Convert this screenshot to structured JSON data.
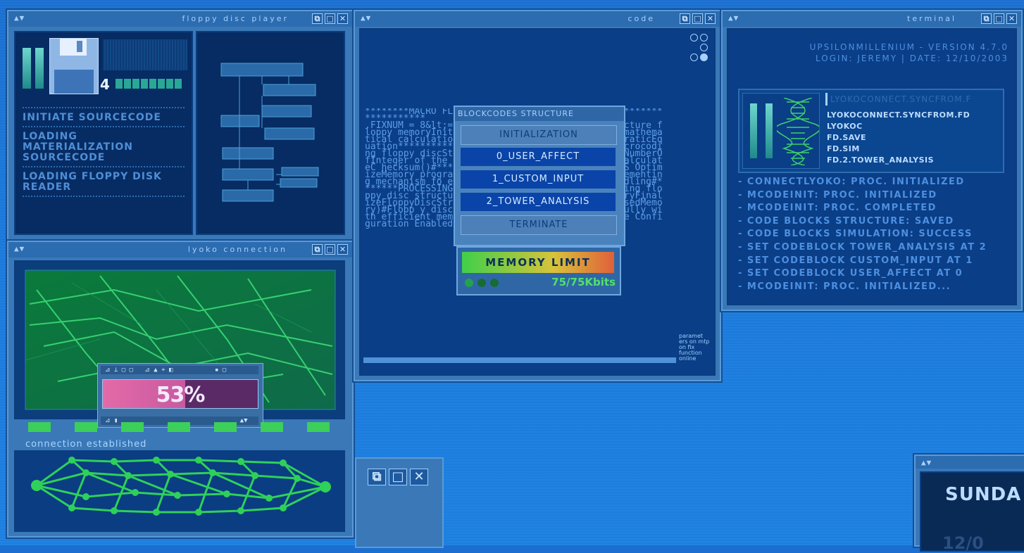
{
  "floppy": {
    "title": "floppy disc player",
    "track_number": "4",
    "menu": [
      "INITIATE SOURCECODE",
      "LOADING MATERIALIZATION SOURCECODE",
      "LOADING FLOPPY DISK READER"
    ]
  },
  "code": {
    "title": "code",
    "text": "********MACRO FLOPPY*********************************************\n.FIXNUM = 8&lt;=Number of macrocoding disc structure floppy memoryInitial AllocateMemory macrocoding mathematical calculations algorithm[Sl neFunction QuadraticEquation*********** *****Create AllocateMemory macrocoding floppy discStoreMat AllocateMemory Size[] * NumberOfInteger of the stored integrity calculations calculateC hecksum()#******** *********codin gExecutionS OptimizeMemory program stru securityEncr 256] # implementing mechanism fo executionImp catch exception handling#*******PROCESSING********* *************#finalizing floppy disc structure and deallocating unused memoryFinalizeFloppyDiscStructure[] + DeallocateMemory(UnusedMemory)#Flopp y disc macrocoding completed successfully with efficient memory utilizationMater Code Source Configuration Enabled",
    "side_note": "paramet ers on mtp on fix function online",
    "blockcodes": {
      "title": "BLOCKCODES STRUCTURE",
      "items": [
        "INITIALIZATION",
        "0_USER_AFFECT",
        "1_CUSTOM_INPUT",
        "2_TOWER_ANALYSIS",
        "TERMINATE"
      ]
    },
    "memory": {
      "label": "MEMORY LIMIT",
      "value": "75/75Kbits"
    }
  },
  "terminal": {
    "title": "terminal",
    "header_line1": "UPSILONMILLENIUM - VERSION 4.7.0",
    "header_line2": "LOGIN: JEREMY | DATE: 12/10/2003",
    "file_header": "LYOKOCONNECT.SYNCFROM.F",
    "files": [
      "LYOKOCONNECT.SYNCFROM.FD",
      "LYOKOC",
      "FD.SAVE",
      "FD.SIM",
      "FD.2.TOWER_ANALYSIS"
    ],
    "log": [
      "- CONNECTLYOKO: PROC. INITIALIZED",
      "- MCODEINIT: PROC. INITIALIZED",
      "- MCODEINIT: PROC. COMPLETED",
      "- CODE BLOCKS STRUCTURE: SAVED",
      "- CODE BLOCKS SIMULATION: SUCCESS",
      "- SET CODEBLOCK TOWER_ANALYSIS AT 2",
      "- SET CODEBLOCK CUSTOM_INPUT AT 1",
      "- SET CODEBLOCK USER_AFFECT AT 0",
      "- MCODEINIT: PROC. INITIALIZED..."
    ]
  },
  "lyoko": {
    "title": "lyoko connection",
    "progress_label": "53%",
    "progress_fraction": 0.53,
    "status": "connection established"
  },
  "sunday": {
    "text": "SUNDA",
    "date": "12/0"
  }
}
